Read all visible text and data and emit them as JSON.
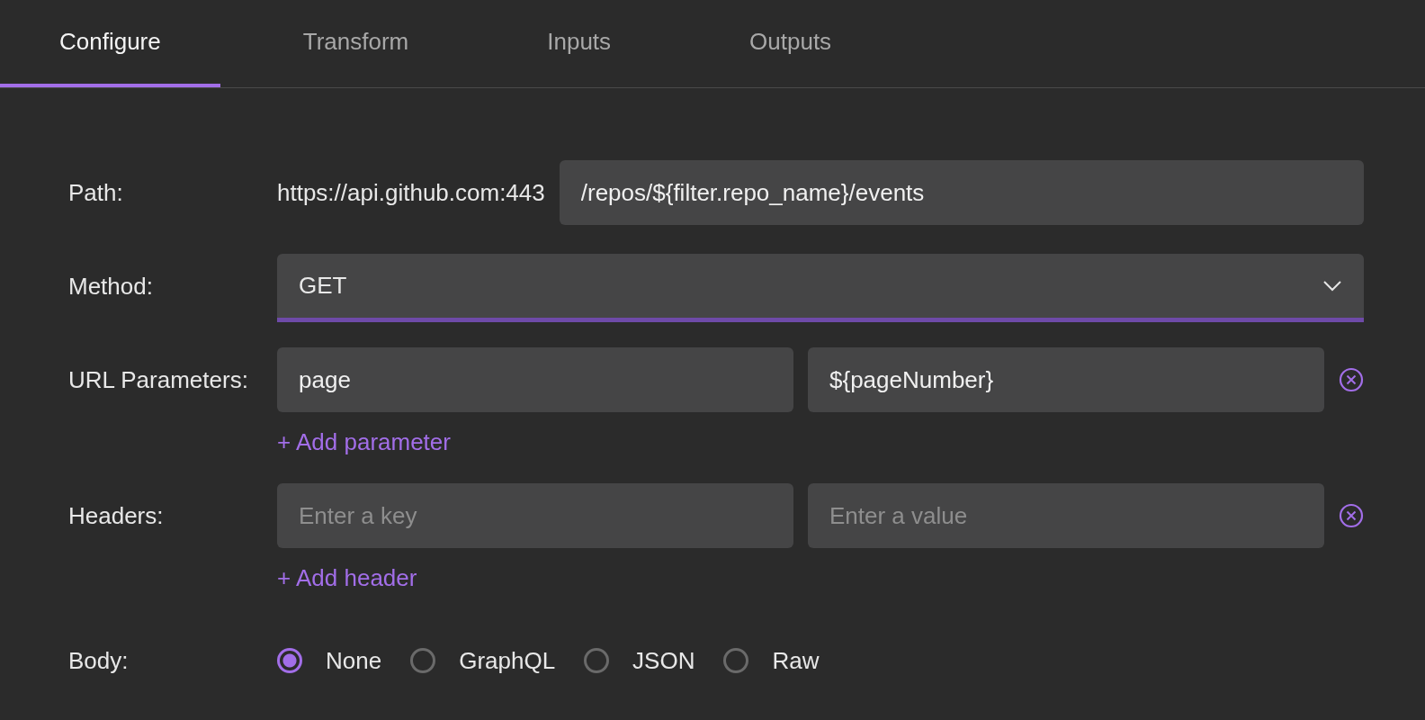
{
  "tabs": [
    {
      "label": "Configure",
      "selected": true
    },
    {
      "label": "Transform",
      "selected": false
    },
    {
      "label": "Inputs",
      "selected": false
    },
    {
      "label": "Outputs",
      "selected": false
    }
  ],
  "form": {
    "path": {
      "label": "Path:",
      "base_url": "https://api.github.com:443",
      "value": "/repos/${filter.repo_name}/events"
    },
    "method": {
      "label": "Method:",
      "value": "GET"
    },
    "url_parameters": {
      "label": "URL Parameters:",
      "rows": [
        {
          "key": "page",
          "value": "${pageNumber}"
        }
      ],
      "add_link": "+ Add parameter"
    },
    "headers": {
      "label": "Headers:",
      "rows": [
        {
          "key_placeholder": "Enter a key",
          "value_placeholder": "Enter a value"
        }
      ],
      "add_link": "+ Add header"
    },
    "body": {
      "label": "Body:",
      "options": [
        {
          "label": "None",
          "selected": true
        },
        {
          "label": "GraphQL",
          "selected": false
        },
        {
          "label": "JSON",
          "selected": false
        },
        {
          "label": "Raw",
          "selected": false
        }
      ]
    }
  }
}
